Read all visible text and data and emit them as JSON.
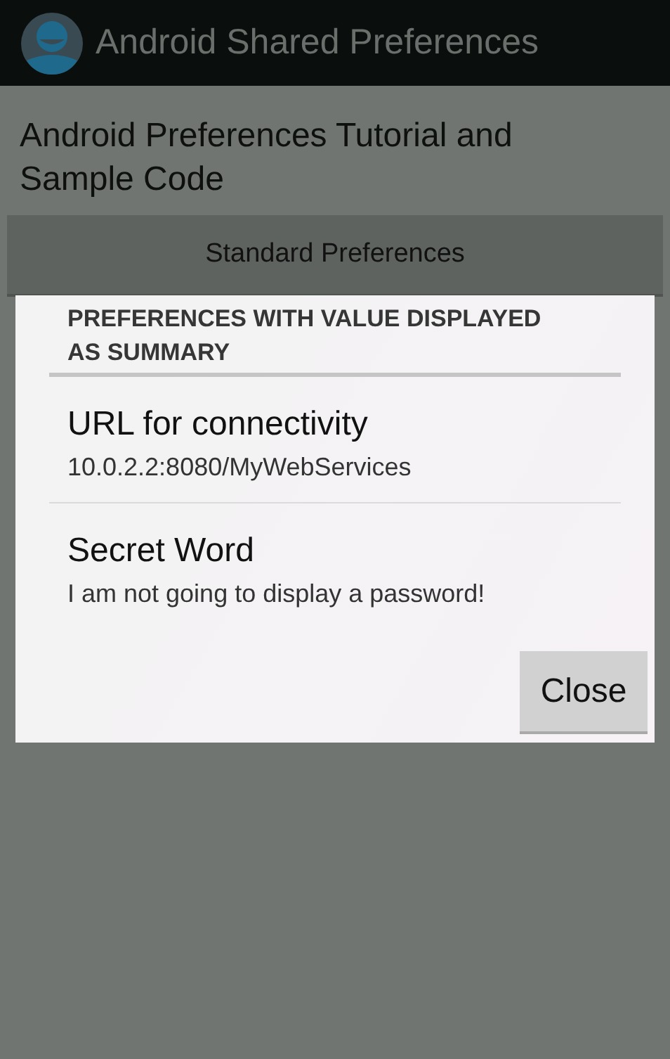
{
  "action_bar": {
    "title": "Android Shared Preferences"
  },
  "heading": "Android Preferences Tutorial and Sample Code",
  "buttons": [
    {
      "label": "Standard Preferences"
    }
  ],
  "dialog": {
    "title": "PREFERENCES WITH VALUE DISPLAYED AS SUMMARY",
    "items": [
      {
        "title": "URL for connectivity",
        "summary": "10.0.2.2:8080/MyWebServices"
      },
      {
        "title": "Secret Word",
        "summary": "I am not going to display a password!"
      }
    ],
    "close_button": "Close"
  }
}
